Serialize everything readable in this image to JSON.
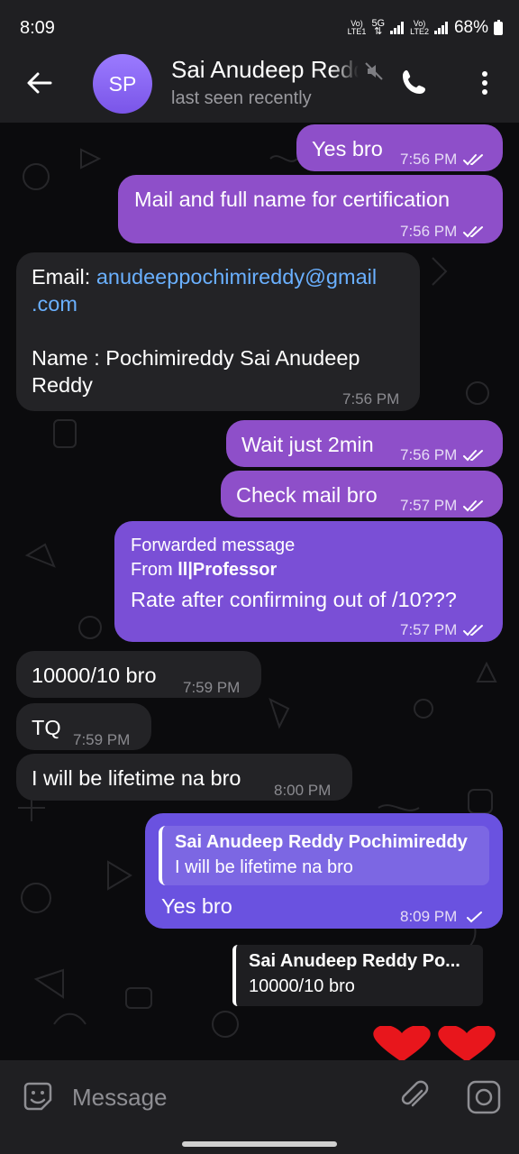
{
  "status": {
    "time": "8:09",
    "battery": "68%",
    "sim1": "Vo)) LTE1",
    "sim2": "Vo)) LTE2",
    "network": "5G"
  },
  "header": {
    "avatar_initials": "SP",
    "name": "Sai Anudeep Reddy Pochimireddy",
    "subtitle": "last seen recently"
  },
  "messages": [
    {
      "text": "Yes bro",
      "time": "7:56 PM"
    },
    {
      "text": "Mail and full name for certification",
      "time": "7:56 PM"
    },
    {
      "email_label": "Email: ",
      "email_line1": "anudeeppochimireddy@gmail",
      "email_line2": ".com",
      "name_line1": "Name : Pochimireddy Sai Anudeep",
      "name_line2": "Reddy",
      "time": "7:56 PM"
    },
    {
      "text": "Wait just 2min",
      "time": "7:56 PM"
    },
    {
      "text": "Check mail bro",
      "time": "7:57 PM"
    },
    {
      "forwarded_label": "Forwarded message",
      "from_prefix": "From ",
      "from_name": "ll|Professor",
      "text": "Rate after confirming out of /10???",
      "time": "7:57 PM"
    },
    {
      "text": "10000/10 bro",
      "time": "7:59 PM"
    },
    {
      "text": "TQ",
      "time": "7:59 PM"
    },
    {
      "text": "I will be lifetime na bro",
      "time": "8:00 PM"
    },
    {
      "reply_name": "Sai Anudeep Reddy Pochimireddy",
      "reply_text": "I will be lifetime na bro",
      "text": "Yes bro",
      "time": "8:09 PM"
    },
    {
      "reply_name": "Sai Anudeep Reddy Po...",
      "reply_text": "10000/10 bro"
    }
  ],
  "input": {
    "placeholder": "Message"
  },
  "colors": {
    "outgoing": "#8e4fc9",
    "outgoing_alt": "#6a52e0",
    "incoming": "#232326",
    "link": "#6ab0ff",
    "header": "#1f1f22"
  }
}
